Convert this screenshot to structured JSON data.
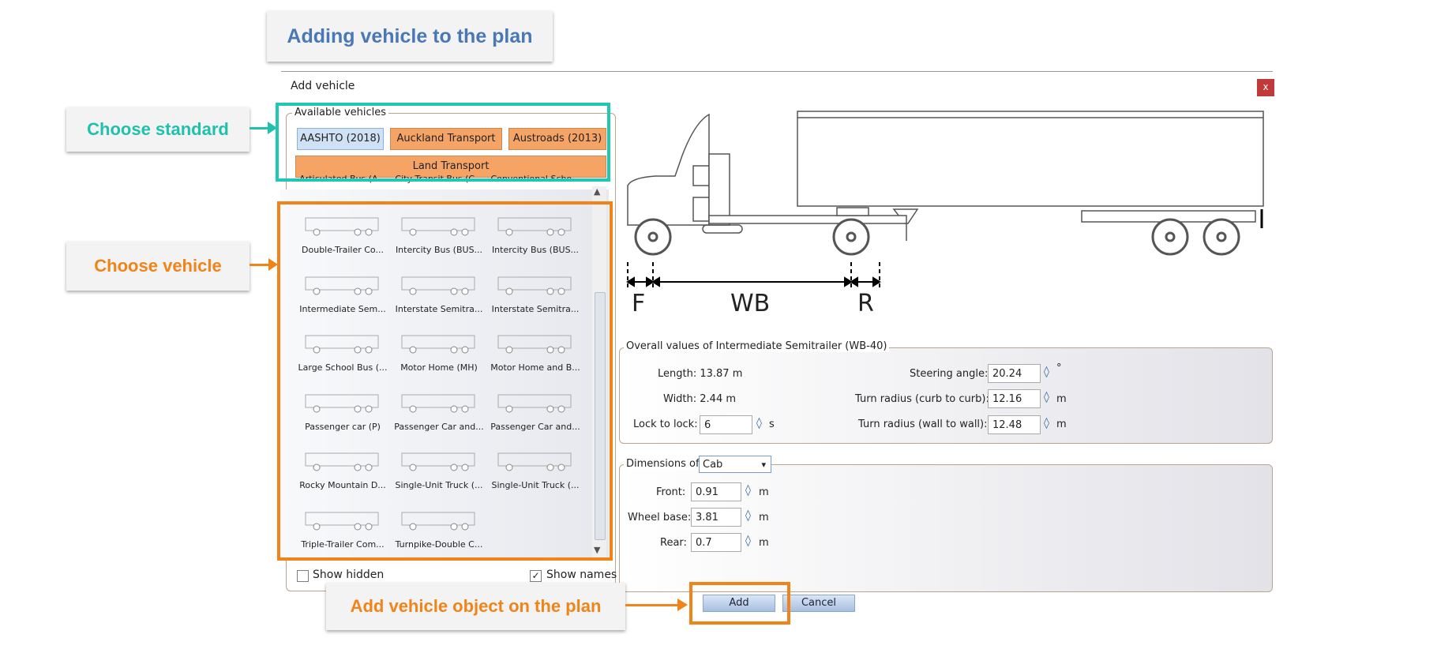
{
  "callouts": {
    "title": "Adding vehicle to the plan",
    "standard": "Choose standard",
    "vehicle": "Choose vehicle",
    "add": "Add vehicle object on the plan"
  },
  "dialog": {
    "title": "Add vehicle",
    "close": "x"
  },
  "available": {
    "group_label": "Available vehicles",
    "standards": [
      "AASHTO (2018)",
      "Auckland Transport",
      "Austroads (2013)",
      "Land Transport"
    ]
  },
  "vehicles": [
    "Articulated Bus (A...",
    "City Transit Bus (C...",
    "Conventional Scho...",
    "Double-Trailer Co...",
    "Intercity Bus (BUS...",
    "Intercity Bus (BUS...",
    "Intermediate Sem...",
    "Interstate Semitra...",
    "Interstate Semitra...",
    "Large School Bus (...",
    "Motor Home (MH)",
    "Motor Home and B...",
    "Passenger car (P)",
    "Passenger Car and...",
    "Passenger Car and...",
    "Rocky Mountain D...",
    "Single-Unit Truck (...",
    "Single-Unit Truck (...",
    "Triple-Trailer Com...",
    "Turnpike-Double C..."
  ],
  "options": {
    "show_hidden": "Show hidden",
    "show_names": "Show names",
    "show_names_check": "✓"
  },
  "diagram": {
    "f": "F",
    "wb": "WB",
    "r": "R"
  },
  "overall": {
    "group_label": "Overall values of Intermediate Semitrailer (WB-40)",
    "length": "Length: 13.87  m",
    "width": "Width: 2.44  m",
    "lock_label": "Lock to lock:",
    "lock_value": "6",
    "lock_unit": "s",
    "steering_label": "Steering angle:",
    "steering_value": "20.24",
    "steering_unit": "°",
    "curb_label": "Turn radius (curb to curb):",
    "curb_value": "12.16",
    "curb_unit": "m",
    "wall_label": "Turn radius (wall to wall):",
    "wall_value": "12.48",
    "wall_unit": "m"
  },
  "dimensions": {
    "label": "Dimensions of",
    "selected": "Cab",
    "front_label": "Front:",
    "front_value": "0.91",
    "wheelbase_label": "Wheel base:",
    "wheelbase_value": "3.81",
    "rear_label": "Rear:",
    "rear_value": "0.7",
    "unit": "m"
  },
  "buttons": {
    "add": "Add",
    "cancel": "Cancel"
  },
  "icons": {
    "spin": "◊",
    "dropdown": "▾",
    "scroll_up": "▲",
    "scroll_down": "▼"
  }
}
